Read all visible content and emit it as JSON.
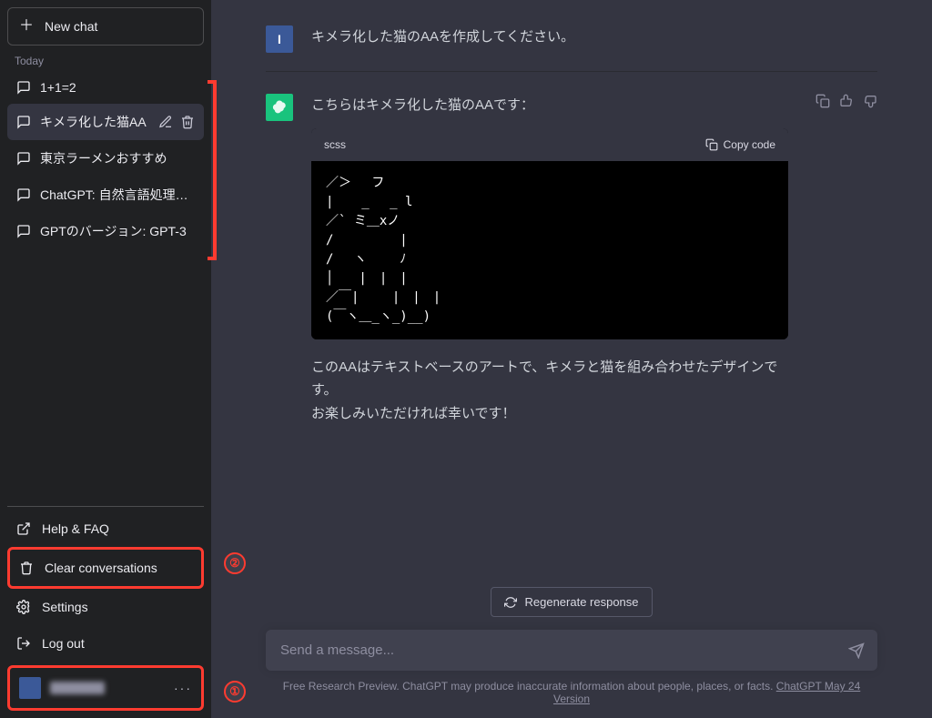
{
  "sidebar": {
    "new_chat": "New chat",
    "today_label": "Today",
    "conversations": [
      {
        "title": "1+1=2"
      },
      {
        "title": "キメラ化した猫AA",
        "active": true
      },
      {
        "title": "東京ラーメンおすすめ"
      },
      {
        "title": "ChatGPT: 自然言語処理モデル"
      },
      {
        "title": "GPTのバージョン: GPT-3"
      }
    ],
    "menu": {
      "help": "Help & FAQ",
      "clear": "Clear conversations",
      "settings": "Settings",
      "logout": "Log out"
    }
  },
  "annotations": {
    "marker1": "①",
    "marker2": "②"
  },
  "chat": {
    "user_msg": "キメラ化した猫のAAを作成してください。",
    "user_initial": "I",
    "bot_intro": "こちらはキメラ化した猫のAAです：",
    "code_lang": "scss",
    "copy_label": "Copy code",
    "ascii_art": "／＞　 フ\n|  　_　 _ l\n／` ミ＿xノ\n/　　　 　 |\n/　 ヽ　　 ﾉ\n│　　|　|　|\n／￣|　　 |　|　|\n(￣ヽ＿_ヽ_)__)",
    "bot_follow1": "このAAはテキストベースのアートで、キメラと猫を組み合わせたデザインです。",
    "bot_follow2": "お楽しみいただければ幸いです！"
  },
  "controls": {
    "regenerate": "Regenerate response",
    "placeholder": "Send a message..."
  },
  "footer": {
    "text": "Free Research Preview. ChatGPT may produce inaccurate information about people, places, or facts. ",
    "link": "ChatGPT May 24 Version"
  }
}
